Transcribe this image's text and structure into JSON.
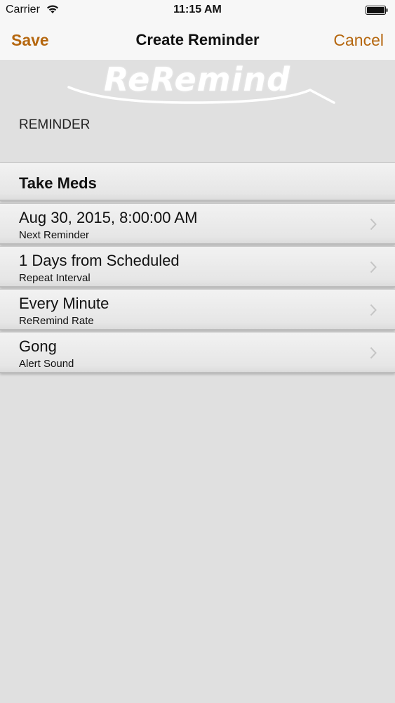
{
  "status_bar": {
    "carrier": "Carrier",
    "time": "11:15 AM"
  },
  "nav": {
    "save_label": "Save",
    "title": "Create Reminder",
    "cancel_label": "Cancel"
  },
  "logo": {
    "text": "ReRemind"
  },
  "section": {
    "header": "REMINDER"
  },
  "name_row": {
    "value": "Take Meds"
  },
  "rows": [
    {
      "value": "Aug 30, 2015, 8:00:00 AM",
      "label": "Next Reminder"
    },
    {
      "value": "1 Days from Scheduled",
      "label": "Repeat Interval"
    },
    {
      "value": "Every Minute",
      "label": "ReRemind Rate"
    },
    {
      "value": "Gong",
      "label": "Alert Sound"
    }
  ],
  "colors": {
    "accent": "#b5670f",
    "background": "#e0e0e0",
    "bar": "#f7f7f7"
  }
}
